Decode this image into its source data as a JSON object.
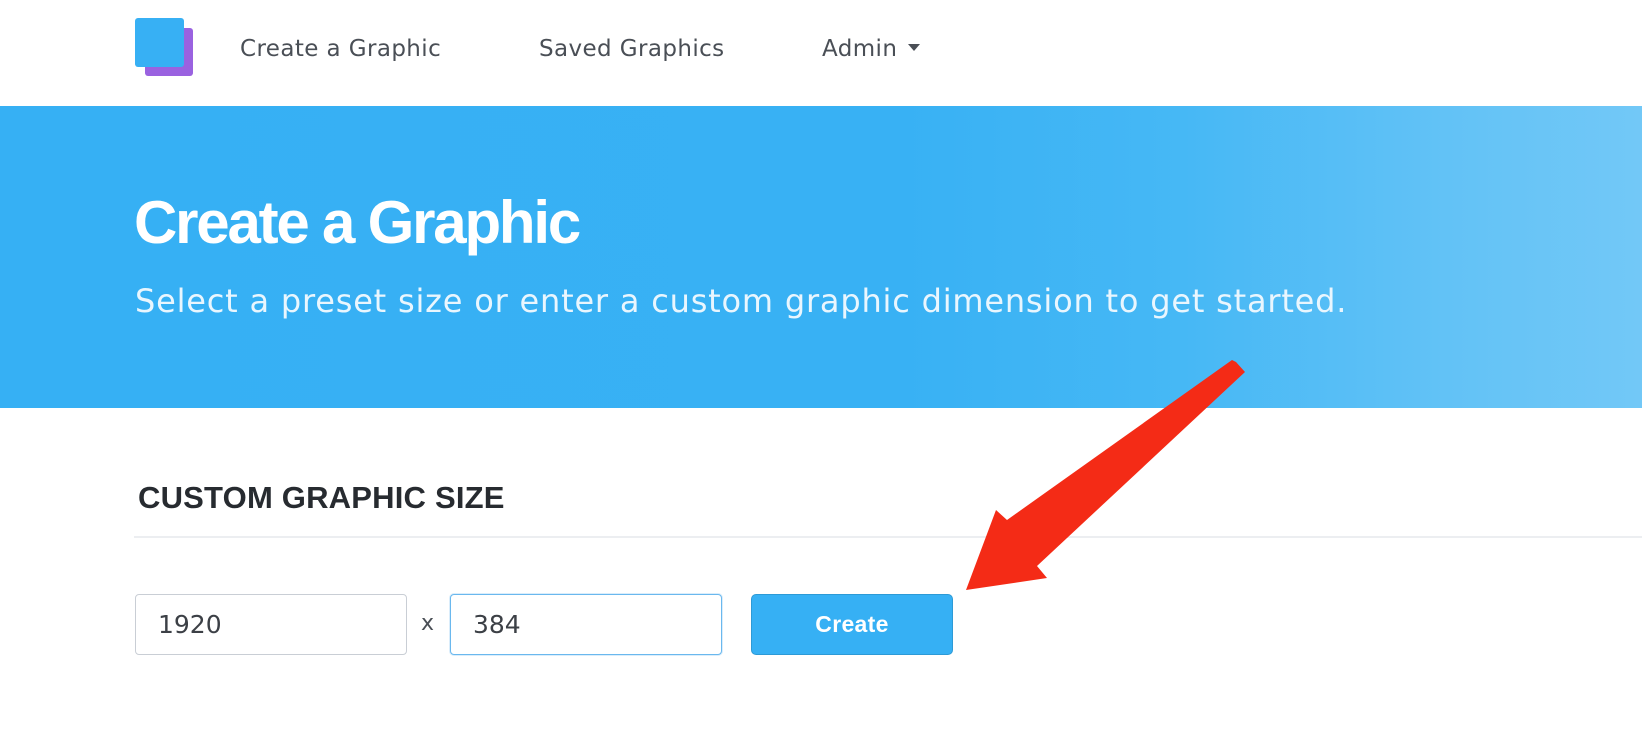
{
  "nav": {
    "items": [
      {
        "label": "Create a Graphic"
      },
      {
        "label": "Saved Graphics"
      },
      {
        "label": "Admin"
      }
    ]
  },
  "hero": {
    "title": "Create a Graphic",
    "subtitle": "Select a preset size or enter a custom graphic dimension to get started."
  },
  "custom_size": {
    "heading": "CUSTOM GRAPHIC SIZE",
    "width_value": "1920",
    "separator": "x",
    "height_value": "384",
    "create_label": "Create"
  },
  "colors": {
    "brand_blue": "#36b0f4",
    "brand_purple": "#9a62e0",
    "annotation_red": "#f42b16"
  },
  "icons": {
    "logo": "logo-icon",
    "admin_dropdown": "caret-down-icon",
    "annotation": "red-arrow-annotation"
  }
}
